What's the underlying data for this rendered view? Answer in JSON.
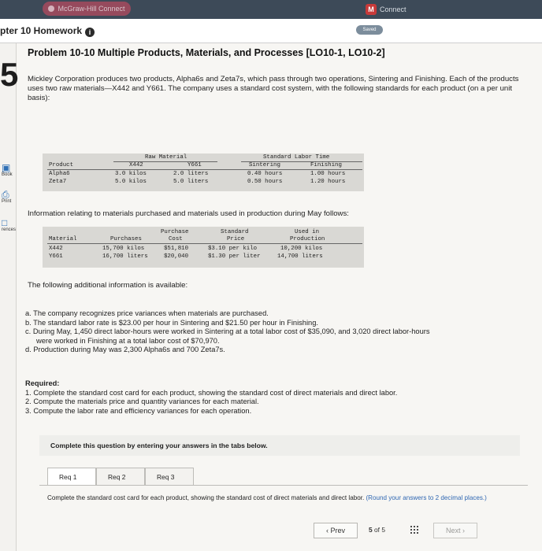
{
  "browser": {
    "tab_title": "McGraw-Hill Connect",
    "connect_label": "Connect",
    "connect_logo": "M"
  },
  "header": {
    "title": "pter 10 Homework",
    "saved_label": "Saved"
  },
  "question_number": "5",
  "rail": {
    "ebook": "Book",
    "print": "Print",
    "references": "rences"
  },
  "problem": {
    "title": "Problem 10-10 Multiple Products, Materials, and Processes [LO10-1, LO10-2]",
    "intro": "Mickley Corporation produces two products, Alpha6s and Zeta7s, which pass through two operations, Sintering and Finishing. Each of the products uses two raw materials—X442 and Y661. The company uses a standard cost system, with the following standards for each product (on a per unit basis):"
  },
  "standards_table": {
    "group_raw": "Raw Material",
    "group_labor": "Standard Labor Time",
    "col_product": "Product",
    "col_x442": "X442",
    "col_y661": "Y661",
    "col_sintering": "Sintering",
    "col_finishing": "Finishing",
    "rows": [
      {
        "product": "Alpha6",
        "x442": "3.0 kilos",
        "y661": "2.0 liters",
        "sintering": "0.40 hours",
        "finishing": "1.00 hours"
      },
      {
        "product": "Zeta7",
        "x442": "5.0 kilos",
        "y661": "5.0 liters",
        "sintering": "0.50 hours",
        "finishing": "1.20 hours"
      }
    ]
  },
  "materials_intro": "Information relating to materials purchased and materials used in production during May follows:",
  "materials_table": {
    "h_material": "Material",
    "h_purchases": "Purchases",
    "h_cost_1": "Purchase",
    "h_cost_2": "Cost",
    "h_price_1": "Standard",
    "h_price_2": "Price",
    "h_used_1": "Used in",
    "h_used_2": "Production",
    "rows": [
      {
        "material": "X442",
        "purchases": "15,700 kilos",
        "cost": "$51,810",
        "price": "$3.10 per kilo",
        "used": "10,200 kilos"
      },
      {
        "material": "Y661",
        "purchases": "16,700 liters",
        "cost": "$20,040",
        "price": "$1.30 per liter",
        "used": "14,700 liters"
      }
    ]
  },
  "additional_intro": "The following additional information is available:",
  "additional": [
    "a. The company recognizes price variances when materials are purchased.",
    "b. The standard labor rate is $23.00 per hour in Sintering and $21.50 per hour in Finishing.",
    "c. During May, 1,450 direct labor-hours were worked in Sintering at a total labor cost of $35,090, and 3,020 direct labor-hours",
    "were worked in Finishing at a total labor cost of $70,970.",
    "d. Production during May was 2,300 Alpha6s and 700 Zeta7s."
  ],
  "required": {
    "heading": "Required:",
    "items": [
      "1. Complete the standard cost card for each product, showing the standard cost of direct materials and direct labor.",
      "2. Compute the materials price and quantity variances for each material.",
      "3. Compute the labor rate and efficiency variances for each operation."
    ]
  },
  "complete_banner": "Complete this question by entering your answers in the tabs below.",
  "tabs": [
    {
      "label": "Req 1"
    },
    {
      "label": "Req 2"
    },
    {
      "label": "Req 3"
    }
  ],
  "instruction": {
    "text": "Complete the standard cost card for each product, showing the standard cost of direct materials and direct labor.",
    "hint": "(Round your answers to 2 decimal places.)"
  },
  "pager": {
    "prev_label": "Prev",
    "current": "5",
    "of_label": "of",
    "total": "5",
    "next_label": "Next"
  },
  "colors": {
    "topbar": "#3d4a58",
    "accent_blue": "#2f67b2",
    "table_bg": "#d9d8d4"
  }
}
